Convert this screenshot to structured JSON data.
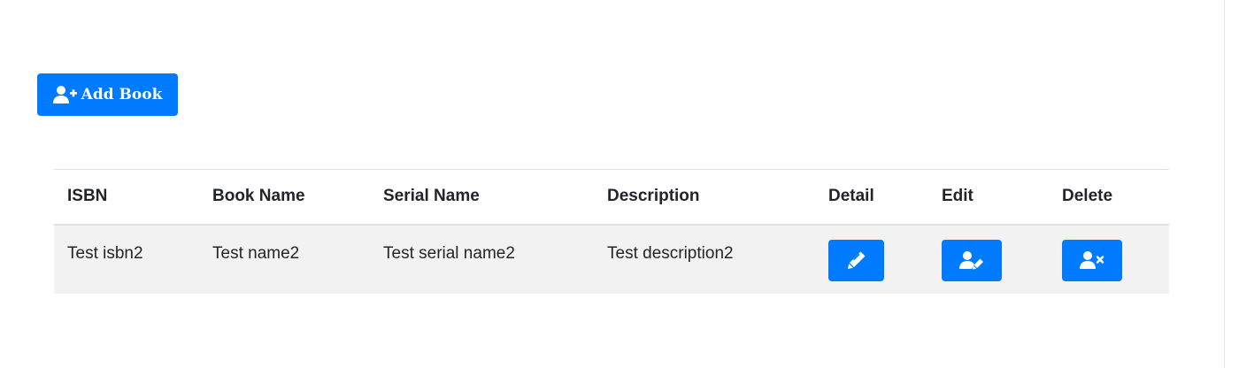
{
  "toolbar": {
    "add_label": "Add Book",
    "add_icon": "user-plus-icon"
  },
  "table": {
    "headers": {
      "isbn": "ISBN",
      "book_name": "Book Name",
      "serial_name": "Serial Name",
      "description": "Description",
      "detail": "Detail",
      "edit": "Edit",
      "delete": "Delete"
    },
    "rows": [
      {
        "isbn": "Test isbn2",
        "book_name": "Test name2",
        "serial_name": "Test serial name2",
        "description": "Test description2",
        "detail_icon": "pen-icon",
        "edit_icon": "user-edit-icon",
        "delete_icon": "user-times-icon"
      }
    ]
  },
  "colors": {
    "primary": "#007bff",
    "row_background": "#f2f2f2",
    "border": "#dee2e6",
    "text": "#212529"
  }
}
